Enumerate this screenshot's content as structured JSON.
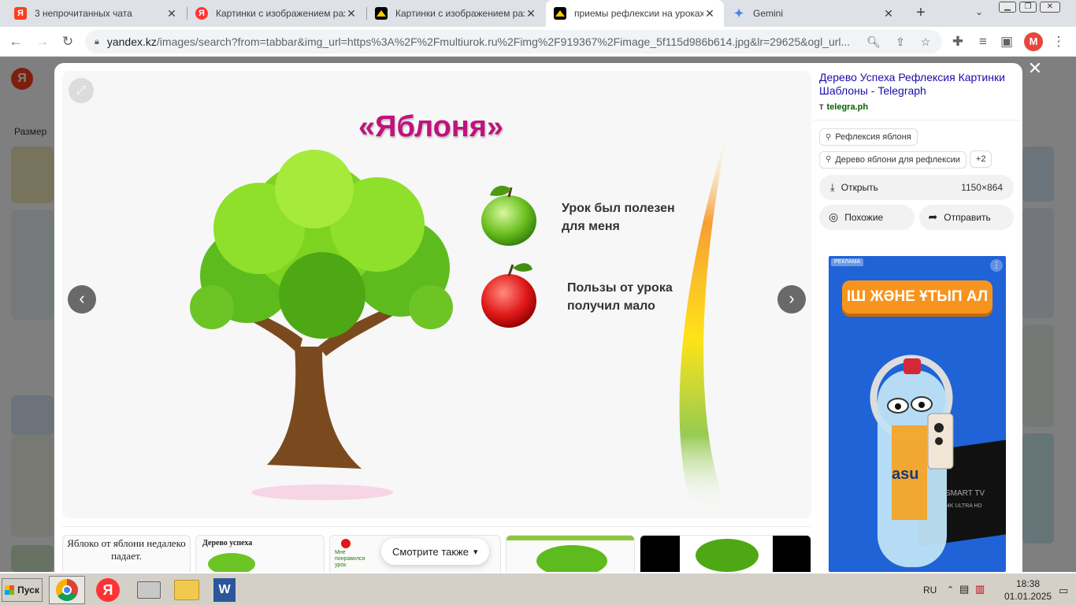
{
  "browser": {
    "tabs": [
      {
        "title": "3 непрочитанных чата",
        "favicon": "yandex-messenger-icon",
        "active": false
      },
      {
        "title": "Картинки с изображением разл",
        "favicon": "yandex-icon",
        "active": false
      },
      {
        "title": "Картинки с изображением разл",
        "favicon": "images-icon",
        "active": false
      },
      {
        "title": "приемы рефлексии на уроках в",
        "favicon": "images-icon",
        "active": true
      },
      {
        "title": "Gemini",
        "favicon": "gemini-icon",
        "active": false
      }
    ],
    "url_domain": "yandex.kz",
    "url_rest": "/images/search?from=tabbar&img_url=https%3A%2F%2Fmultiurok.ru%2Fimg%2F919367%2Fimage_5f115d986b614.jpg&lr=29625&ogl_url...",
    "profile_initial": "M"
  },
  "page_bg": {
    "size_filter": "Размер"
  },
  "viewer": {
    "slide_title": "«Яблоня»",
    "label_green": "Урок был полезен для меня",
    "label_red": "Пользы от урока получил мало"
  },
  "thumbnails": [
    {
      "caption": "Яблоко от яблони недалеко падает."
    },
    {
      "caption": "Дерево успеха"
    },
    {
      "caption": "Мне понравился урок"
    },
    {
      "caption": ""
    },
    {
      "caption": ""
    }
  ],
  "see_also_label": "Смотрите также",
  "side": {
    "title": "Дерево Успеха Рефлексия Картинки Шаблоны - Telegraph",
    "source": "telegra.ph",
    "chips": [
      "Рефлексия яблоня",
      "Дерево яблони для рефлексии",
      "+2"
    ],
    "open_label": "Открыть",
    "image_size": "1150×864",
    "similar_label": "Похожие",
    "share_label": "Отправить"
  },
  "ad": {
    "badge": "РЕКЛАМА",
    "cta": "ІШ ЖӘНЕ ҰТЫП АЛ",
    "brand": "asu",
    "tv_text": "SMART TV",
    "tv_sub": "4K ULTRA HD"
  },
  "taskbar": {
    "start_label": "Пуск",
    "lang": "RU",
    "time": "18:38",
    "date": "01.01.2025"
  },
  "colors": {
    "title_magenta": "#c0127c",
    "link_blue": "#1a0dab",
    "source_green": "#006000",
    "ad_blue": "#1f63d6",
    "ad_orange": "#f7941d"
  }
}
